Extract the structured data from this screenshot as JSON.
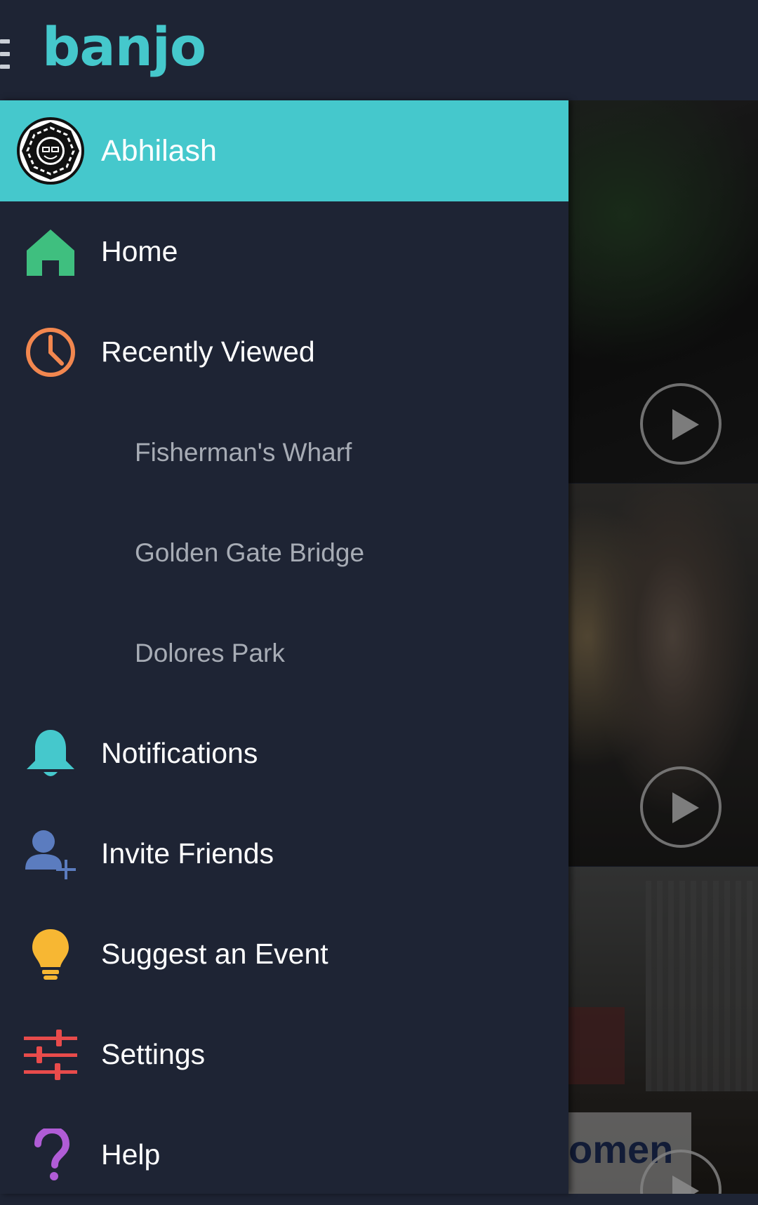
{
  "app": {
    "logo_text": "banjo",
    "accent_color": "#45c8cc",
    "background_color": "#1e2434"
  },
  "drawer": {
    "profile": {
      "name": "Abhilash",
      "avatar_icon": "dharma-logo-avatar"
    },
    "items": [
      {
        "label": "Home",
        "icon": "home-icon",
        "color": "#3fbf7f"
      },
      {
        "label": "Recently Viewed",
        "icon": "clock-icon",
        "color": "#f2874f"
      },
      {
        "label": "Fisherman's Wharf",
        "sub": true
      },
      {
        "label": "Golden Gate Bridge",
        "sub": true
      },
      {
        "label": "Dolores Park",
        "sub": true
      },
      {
        "label": "Notifications",
        "icon": "bell-icon",
        "color": "#45c8cc"
      },
      {
        "label": "Invite Friends",
        "icon": "add-user-icon",
        "color": "#5b7cbf"
      },
      {
        "label": "Suggest an Event",
        "icon": "lightbulb-icon",
        "color": "#f7b733"
      },
      {
        "label": "Settings",
        "icon": "sliders-icon",
        "color": "#e84b4b"
      },
      {
        "label": "Help",
        "icon": "question-icon",
        "color": "#b05cd6"
      }
    ]
  },
  "feed": {
    "cards": [
      {
        "icon": "play-icon"
      },
      {
        "icon": "play-icon"
      },
      {
        "icon": "play-icon",
        "banner_text": "omen"
      }
    ]
  }
}
